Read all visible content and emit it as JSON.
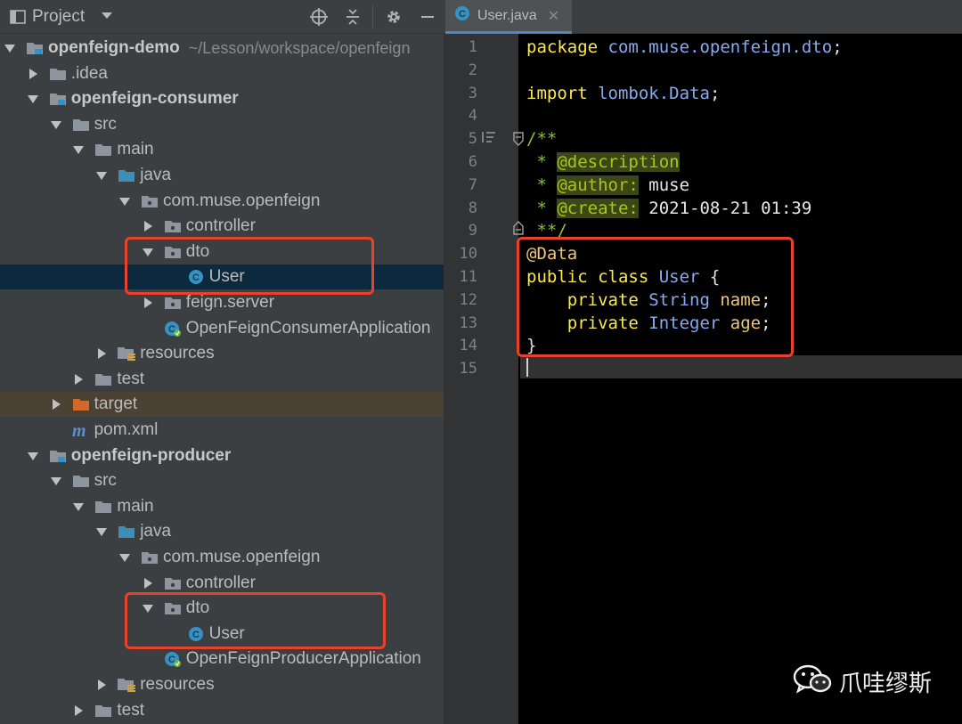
{
  "project_panel": {
    "title": "Project",
    "header_icons": [
      "crosshair-icon",
      "collapse-icon",
      "gear-icon",
      "minimize-icon"
    ],
    "tree": [
      {
        "label": "openfeign-demo",
        "hint": "~/Lesson/workspace/openfeign",
        "icon": "module-folder-icon",
        "arrow": "down",
        "level": 0,
        "bold": true
      },
      {
        "label": ".idea",
        "icon": "folder-icon",
        "arrow": "right",
        "level": 1
      },
      {
        "label": "openfeign-consumer",
        "icon": "module-folder-icon",
        "arrow": "down",
        "level": 1,
        "bold": true
      },
      {
        "label": "src",
        "icon": "folder-icon",
        "arrow": "down",
        "level": 2
      },
      {
        "label": "main",
        "icon": "folder-icon",
        "arrow": "down",
        "level": 3
      },
      {
        "label": "java",
        "icon": "source-folder-icon",
        "arrow": "down",
        "level": 4
      },
      {
        "label": "com.muse.openfeign",
        "icon": "package-icon",
        "arrow": "down",
        "level": 5
      },
      {
        "label": "controller",
        "icon": "package-icon",
        "arrow": "right",
        "level": 6
      },
      {
        "label": "dto",
        "icon": "package-icon",
        "arrow": "down",
        "level": 6
      },
      {
        "label": "User",
        "icon": "class-icon",
        "arrow": "none",
        "level": 7,
        "selected": true
      },
      {
        "label": "feign.server",
        "icon": "package-icon",
        "arrow": "right",
        "level": 6
      },
      {
        "label": "OpenFeignConsumerApplication",
        "icon": "spring-class-icon",
        "arrow": "none",
        "level": 6
      },
      {
        "label": "resources",
        "icon": "resources-folder-icon",
        "arrow": "right",
        "level": 4
      },
      {
        "label": "test",
        "icon": "folder-icon",
        "arrow": "right",
        "level": 3
      },
      {
        "label": "target",
        "icon": "excluded-folder-icon",
        "arrow": "right",
        "level": 2,
        "highlight": true
      },
      {
        "label": "pom.xml",
        "icon": "maven-icon",
        "arrow": "none",
        "level": 2
      },
      {
        "label": "openfeign-producer",
        "icon": "module-folder-icon",
        "arrow": "down",
        "level": 1,
        "bold": true
      },
      {
        "label": "src",
        "icon": "folder-icon",
        "arrow": "down",
        "level": 2
      },
      {
        "label": "main",
        "icon": "folder-icon",
        "arrow": "down",
        "level": 3
      },
      {
        "label": "java",
        "icon": "source-folder-icon",
        "arrow": "down",
        "level": 4
      },
      {
        "label": "com.muse.openfeign",
        "icon": "package-icon",
        "arrow": "down",
        "level": 5
      },
      {
        "label": "controller",
        "icon": "package-icon",
        "arrow": "right",
        "level": 6
      },
      {
        "label": "dto",
        "icon": "package-icon",
        "arrow": "down",
        "level": 6
      },
      {
        "label": "User",
        "icon": "class-icon",
        "arrow": "none",
        "level": 7
      },
      {
        "label": "OpenFeignProducerApplication",
        "icon": "spring-class-icon",
        "arrow": "none",
        "level": 6
      },
      {
        "label": "resources",
        "icon": "resources-folder-icon",
        "arrow": "right",
        "level": 4
      },
      {
        "label": "test",
        "icon": "folder-icon",
        "arrow": "right",
        "level": 3
      }
    ]
  },
  "editor": {
    "tab": {
      "label": "User.java",
      "close": "✕",
      "icon": "class-icon"
    },
    "line_numbers": [
      "1",
      "2",
      "3",
      "4",
      "5",
      "6",
      "7",
      "8",
      "9",
      "10",
      "11",
      "12",
      "13",
      "14",
      "15"
    ],
    "lines": [
      [
        {
          "t": "package",
          "c": "kw"
        },
        {
          "t": " ",
          "c": "plain"
        },
        {
          "t": "com.muse.openfeign.dto",
          "c": "pkg"
        },
        {
          "t": ";",
          "c": "punc"
        }
      ],
      [],
      [
        {
          "t": "import",
          "c": "kw"
        },
        {
          "t": " ",
          "c": "plain"
        },
        {
          "t": "lombok.",
          "c": "pkg"
        },
        {
          "t": "Data",
          "c": "pkg"
        },
        {
          "t": ";",
          "c": "punc"
        }
      ],
      [],
      [
        {
          "t": "/**",
          "c": "doc"
        }
      ],
      [
        {
          "t": " * ",
          "c": "doc"
        },
        {
          "t": "@description",
          "c": "tag"
        }
      ],
      [
        {
          "t": " * ",
          "c": "doc"
        },
        {
          "t": "@author:",
          "c": "tag"
        },
        {
          "t": " muse",
          "c": "plain"
        }
      ],
      [
        {
          "t": " * ",
          "c": "doc"
        },
        {
          "t": "@create:",
          "c": "tag"
        },
        {
          "t": " 2021-08-21 01:39",
          "c": "plain"
        }
      ],
      [
        {
          "t": " **/",
          "c": "doc"
        }
      ],
      [
        {
          "t": "@Data",
          "c": "ann"
        }
      ],
      [
        {
          "t": "public class ",
          "c": "kw"
        },
        {
          "t": "User",
          "c": "cls"
        },
        {
          "t": " {",
          "c": "punc"
        }
      ],
      [
        {
          "t": "    private ",
          "c": "kw"
        },
        {
          "t": "String",
          "c": "cls"
        },
        {
          "t": " name",
          "c": "ident"
        },
        {
          "t": ";",
          "c": "punc"
        }
      ],
      [
        {
          "t": "    private ",
          "c": "kw"
        },
        {
          "t": "Integer",
          "c": "cls"
        },
        {
          "t": " age",
          "c": "ident"
        },
        {
          "t": ";",
          "c": "punc"
        }
      ],
      [
        {
          "t": "}",
          "c": "punc"
        }
      ],
      []
    ]
  },
  "watermark": {
    "text": "爪哇缪斯",
    "icon": "wechat-icon"
  },
  "colors": {
    "highlight_box": "#e8412c",
    "selection": "#0d293e",
    "tab_underline": "#4a88c7"
  }
}
